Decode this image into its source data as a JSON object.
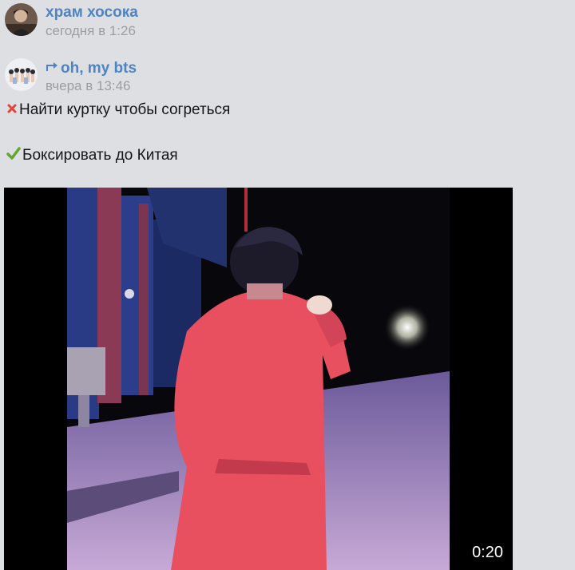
{
  "feed": {
    "posts": [
      {
        "author": "храм хосока",
        "time": "сегодня в 1:26",
        "avatar_icon": "person-photo-avatar"
      },
      {
        "author": "oh, my bts",
        "time": "вчера в 13:46",
        "avatar_icon": "group-photo-avatar",
        "repost_icon": "repost-arrow-icon",
        "lines": [
          {
            "icon": "red-cross-mark-icon",
            "text": "Найти куртку чтобы согреться"
          },
          {
            "icon": "green-check-mark-icon",
            "text": "Боксировать до Китая"
          }
        ],
        "video": {
          "duration": "0:20"
        }
      }
    ]
  },
  "colors": {
    "background": "#dedfe2",
    "author_link": "#4d84c4",
    "timestamp": "#9b9ea4",
    "cross_mark": "#e0453a",
    "check_mark": "#5fa82a"
  }
}
